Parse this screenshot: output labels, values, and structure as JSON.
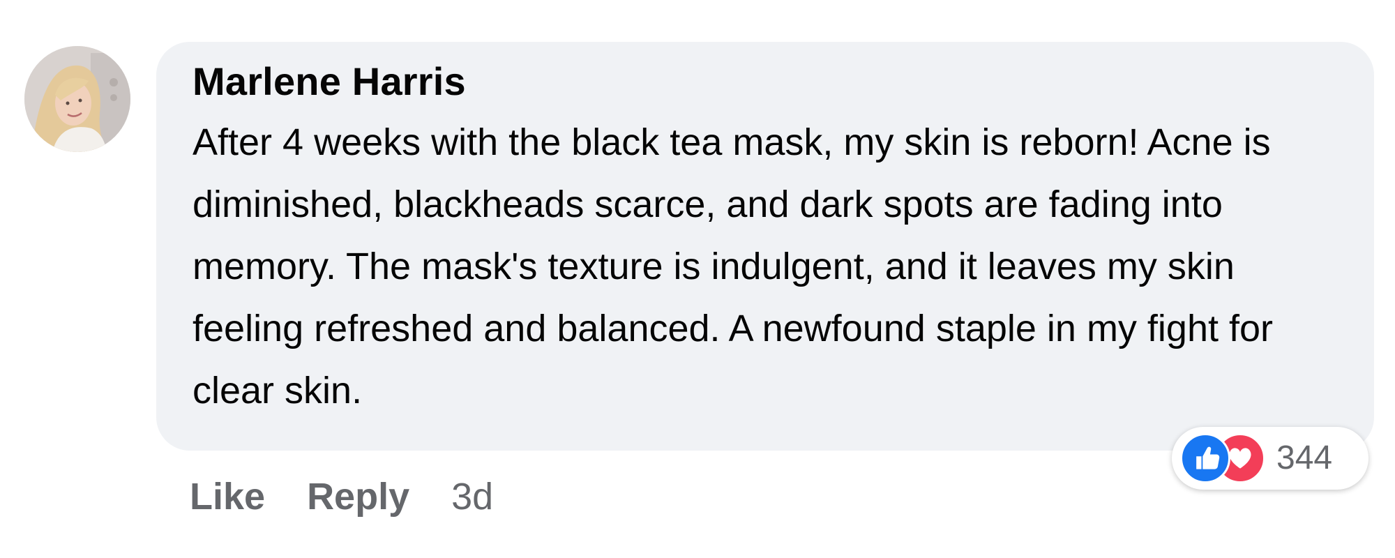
{
  "comment": {
    "author": "Marlene Harris",
    "text": "After 4 weeks with the black tea mask, my skin is reborn! Acne is diminished, blackheads scarce, and dark spots are fading into memory. The mask's texture is indulgent, and it leaves my skin feeling refreshed and balanced. A newfound staple in my fight for clear skin.",
    "avatar_icon": "profile-photo",
    "reactions": {
      "icons": [
        "like-icon",
        "love-icon"
      ],
      "count": "344",
      "colors": {
        "like": "#1877f2",
        "love": "#f33e58"
      }
    },
    "actions": {
      "like_label": "Like",
      "reply_label": "Reply",
      "timestamp": "3d"
    }
  },
  "colors": {
    "bubble_bg": "#f0f2f5",
    "text": "#050505",
    "secondary_text": "#65676b"
  }
}
